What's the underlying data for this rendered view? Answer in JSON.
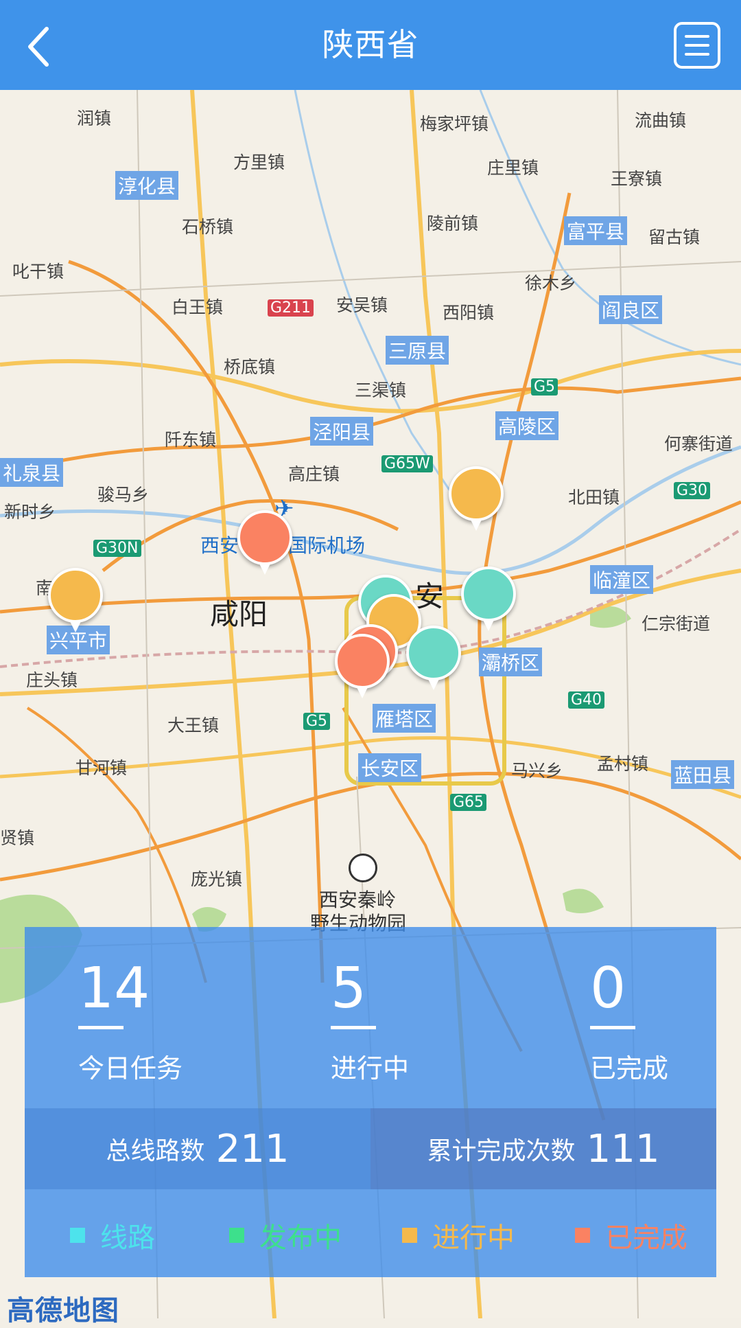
{
  "header": {
    "title": "陕西省",
    "bg_color": "#3f93ea"
  },
  "map": {
    "districts": [
      "淳化县",
      "富平县",
      "阎良区",
      "三原县",
      "泾阳县",
      "高陵区",
      "礼泉县",
      "兴平市",
      "临潼区",
      "灞桥区",
      "雁塔区",
      "长安区",
      "蓝田县"
    ],
    "places": [
      "润镇",
      "梅家坪镇",
      "流曲镇",
      "方里镇",
      "庄里镇",
      "王寮镇",
      "石桥镇",
      "陵前镇",
      "留古镇",
      "叱干镇",
      "白王镇",
      "安吴镇",
      "西阳镇",
      "徐木乡",
      "桥底镇",
      "三渠镇",
      "阡东镇",
      "高庄镇",
      "骏马乡",
      "北田镇",
      "新时乡",
      "何寨街道",
      "庄头镇",
      "仁宗街道",
      "大王镇",
      "马兴乡",
      "孟村镇",
      "甘河镇",
      "庞光镇",
      "贤镇",
      "南",
      "咸阳",
      "安"
    ],
    "highways": [
      "G211",
      "G5",
      "G65W",
      "G30N",
      "G30",
      "G40",
      "G65",
      "G5"
    ],
    "poi_airport": "西安咸阳国际机场",
    "poi_airport_left": "西安",
    "poi_airport_right": "国际机场",
    "poi_zoo_line1": "西安秦岭",
    "poi_zoo_line2": "野生动物园",
    "provider_logo": "高德地图",
    "markers": [
      {
        "status": "completed",
        "color": "#fa8262"
      },
      {
        "status": "in_progress",
        "color": "#f5b94c"
      },
      {
        "status": "in_progress",
        "color": "#f5b94c"
      },
      {
        "status": "publishing",
        "color": "#6ad8c5"
      },
      {
        "status": "publishing",
        "color": "#6ad8c5"
      },
      {
        "status": "in_progress",
        "color": "#f5b94c"
      },
      {
        "status": "publishing",
        "color": "#6ad8c5"
      },
      {
        "status": "completed",
        "color": "#fa8262"
      },
      {
        "status": "completed",
        "color": "#fa8262"
      }
    ]
  },
  "stats": {
    "today_tasks": {
      "value": "14",
      "label": "今日任务"
    },
    "in_progress": {
      "value": "5",
      "label": "进行中"
    },
    "completed": {
      "value": "0",
      "label": "已完成"
    },
    "total_routes": {
      "label": "总线路数",
      "value": "211"
    },
    "total_completions": {
      "label": "累计完成次数",
      "value": "111"
    }
  },
  "legend": [
    {
      "label": "线路",
      "color": "#4de3ec"
    },
    {
      "label": "发布中",
      "color": "#3de08c"
    },
    {
      "label": "进行中",
      "color": "#f5b94c"
    },
    {
      "label": "已完成",
      "color": "#fa8262"
    }
  ]
}
